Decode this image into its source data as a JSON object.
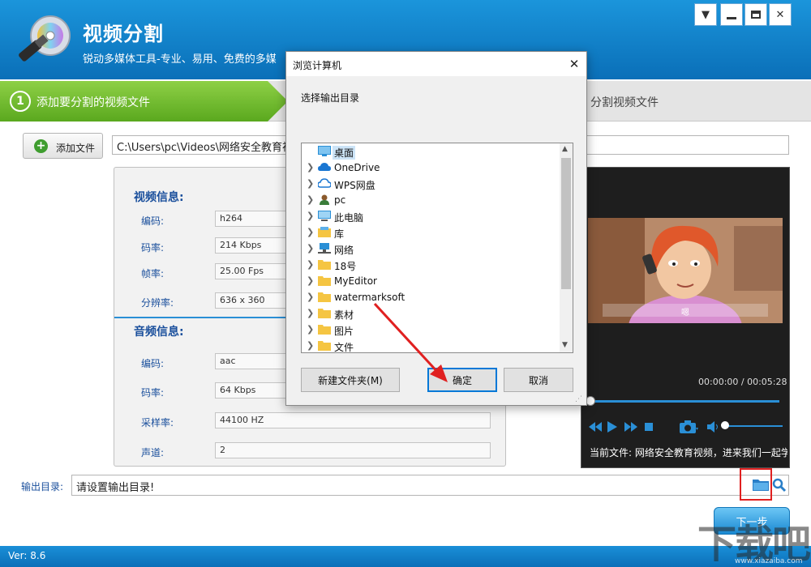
{
  "app": {
    "title": "视频分割",
    "subtitle": "锐动多媒体工具-专业、易用、免费的多媒",
    "window_controls": [
      "menu-icon",
      "minimize-icon",
      "maximize-icon",
      "close-icon"
    ]
  },
  "steps": {
    "step1_number": "1",
    "step1_label": "添加要分割的视频文件",
    "step3_label": "分割视频文件"
  },
  "toolbar": {
    "add_file_label": "添加文件",
    "path_value": "C:\\Users\\pc\\Videos\\网络安全教育视"
  },
  "video_info": {
    "heading": "视频信息:",
    "rows": [
      {
        "label": "编码:",
        "value": "h264"
      },
      {
        "label": "码率:",
        "value": "214 Kbps"
      },
      {
        "label": "帧率:",
        "value": "25.00 Fps"
      },
      {
        "label": "分辨率:",
        "value": "636 x 360"
      }
    ]
  },
  "audio_info": {
    "heading": "音频信息:",
    "rows": [
      {
        "label": "编码:",
        "value": "aac"
      },
      {
        "label": "码率:",
        "value": "64 Kbps"
      },
      {
        "label": "采样率:",
        "value": "44100 HZ"
      },
      {
        "label": "声道:",
        "value": "2"
      }
    ]
  },
  "player": {
    "subtitle_text": "嗯",
    "time": "00:00:00 / 00:05:28",
    "progress": 0,
    "volume": 0,
    "current_file": "当前文件: 网络安全教育视频，进来我们一起学"
  },
  "output": {
    "label": "输出目录:",
    "value": "请设置输出目录!"
  },
  "next_label": "下一步",
  "version": "Ver: 8.6",
  "watermark": "下载吧",
  "watermark_url": "www.xiazaiba.com",
  "dialog": {
    "title": "浏览计算机",
    "prompt": "选择输出目录",
    "tree": [
      {
        "label": "桌面",
        "icon": "desktop-icon",
        "selected": true
      },
      {
        "label": "OneDrive",
        "icon": "cloud-icon"
      },
      {
        "label": "WPS网盘",
        "icon": "cloud-outline-icon"
      },
      {
        "label": "pc",
        "icon": "user-icon"
      },
      {
        "label": "此电脑",
        "icon": "computer-icon"
      },
      {
        "label": "库",
        "icon": "library-icon"
      },
      {
        "label": "网络",
        "icon": "network-icon"
      },
      {
        "label": "18号",
        "icon": "folder-icon"
      },
      {
        "label": "MyEditor",
        "icon": "folder-icon"
      },
      {
        "label": "watermarksoft",
        "icon": "folder-icon"
      },
      {
        "label": "素材",
        "icon": "folder-icon"
      },
      {
        "label": "图片",
        "icon": "folder-icon"
      },
      {
        "label": "文件",
        "icon": "folder-icon"
      }
    ],
    "new_folder_label": "新建文件夹(M)",
    "ok_label": "确定",
    "cancel_label": "取消"
  },
  "colors": {
    "header_blue": "#0a6fb8",
    "step_green": "#5aa81e",
    "label_blue": "#1a4f9c",
    "highlight_red": "#e02020"
  }
}
